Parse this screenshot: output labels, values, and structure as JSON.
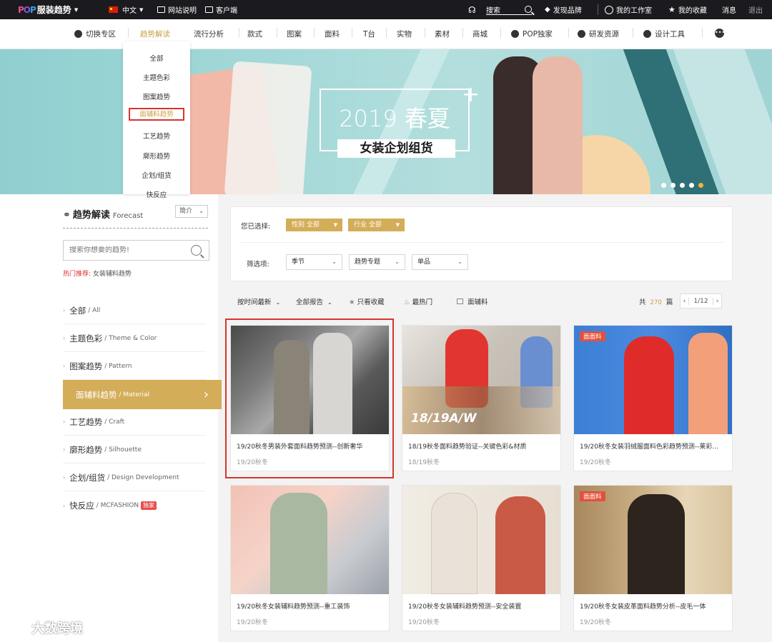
{
  "topbar": {
    "brand_pop": "POP",
    "brand_cn": "服装趋势",
    "language": "中文",
    "site_guide": "网站说明",
    "client": "客户端",
    "search_label": "搜索",
    "discover_brand": "发现品牌",
    "workspace": "我的工作室",
    "favorites": "我的收藏",
    "messages": "消息",
    "logout": "退出"
  },
  "nav": {
    "items": [
      "切换专区",
      "趋势解读",
      "流行分析",
      "款式",
      "图案",
      "面料",
      "T台",
      "实物",
      "素材",
      "商城",
      "POP独家",
      "研发资源",
      "设计工具"
    ]
  },
  "dropdown": {
    "items": [
      "全部",
      "主题色彩",
      "图案趋势",
      "面辅料趋势",
      "工艺趋势",
      "廓形趋势",
      "企划/组货",
      "快反应"
    ]
  },
  "banner": {
    "title": "2019 春夏",
    "subtitle": "女装企划组货"
  },
  "sidebar": {
    "title": "趋势解读",
    "title_en": "Forecast",
    "sort": "简介",
    "search_placeholder": "搜索你想要的趋势!",
    "hot_label": "热门推荐:",
    "hot_value": "女装辅料趋势",
    "items": [
      {
        "zh": "全部",
        "en": "/ All"
      },
      {
        "zh": "主题色彩",
        "en": "/ Theme & Color"
      },
      {
        "zh": "图案趋势",
        "en": "/ Pattern"
      },
      {
        "zh": "面辅料趋势",
        "en": "/ Material"
      },
      {
        "zh": "工艺趋势",
        "en": "/ Craft"
      },
      {
        "zh": "廓形趋势",
        "en": "/ Silhouette"
      },
      {
        "zh": "企划/组货",
        "en": "/ Design Development"
      },
      {
        "zh": "快反应",
        "en": "/ MCFASHION"
      }
    ],
    "new_badge": "独家"
  },
  "filter": {
    "selected_label": "您已选择:",
    "tag_gender": "性别 全部",
    "tag_industry": "行业 全部",
    "options_label": "筛选项:",
    "sel_season": "季节",
    "sel_topic": "趋势专题",
    "sel_item": "单品"
  },
  "toolbar": {
    "sort_time": "按时间最新",
    "all_reports": "全部报告",
    "only_fav": "只看收藏",
    "hottest": "最热门",
    "fabric": "面辅料",
    "total_prefix": "共",
    "total_count": "270",
    "total_suffix": "篇",
    "page": "1/12"
  },
  "cards": [
    {
      "title": "19/20秋冬男装外套面料趋势预测--创新奢华",
      "season": "19/20秋冬",
      "label": "",
      "year_overlay": ""
    },
    {
      "title": "18/19秋冬面料趋势验证--关键色彩&材质",
      "season": "18/19秋冬",
      "label": "",
      "year_overlay": "18/19A/W"
    },
    {
      "title": "19/20秋冬女装羽绒服面料色彩趋势预测--莱彩...",
      "season": "19/20秋冬",
      "label": "面面料",
      "year_overlay": ""
    },
    {
      "title": "19/20秋冬女装辅料趋势预测--重工装饰",
      "season": "19/20秋冬",
      "label": "",
      "year_overlay": ""
    },
    {
      "title": "19/20秋冬女装辅料趋势预测--安全装置",
      "season": "19/20秋冬",
      "label": "",
      "year_overlay": ""
    },
    {
      "title": "19/20秋冬女装皮革面料趋势分析--皮毛一体",
      "season": "19/20秋冬",
      "label": "面面料",
      "year_overlay": ""
    }
  ],
  "watermark": "大数跨境",
  "colors": {
    "accent": "#d3ad58",
    "highlight": "#d8342c",
    "topbar": "#1b1b1f",
    "banner": "#9fd6d6"
  }
}
